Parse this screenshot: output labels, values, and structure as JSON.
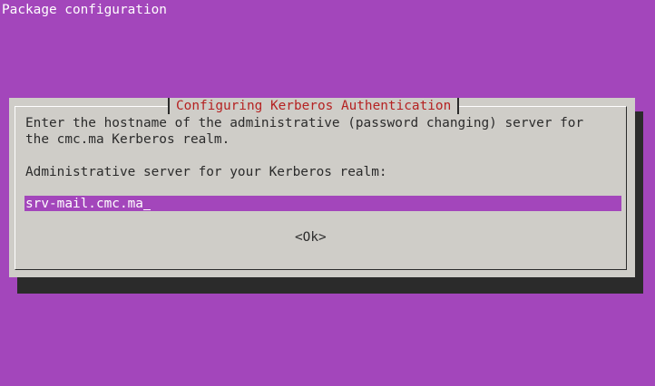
{
  "screen": {
    "title": "Package configuration"
  },
  "dialog": {
    "title": "Configuring Kerberos Authentication",
    "prompt_line1": "Enter the hostname of the administrative (password changing) server for",
    "prompt_line2": "the cmc.ma Kerberos realm.",
    "field_label": "Administrative server for your Kerberos realm:",
    "field_value": "srv-mail.cmc.ma",
    "ok_label": "<Ok>"
  },
  "colors": {
    "background": "#a346bb",
    "dialog": "#cfcdc8",
    "title_text": "#b52222",
    "shadow": "#2b2b2b"
  }
}
